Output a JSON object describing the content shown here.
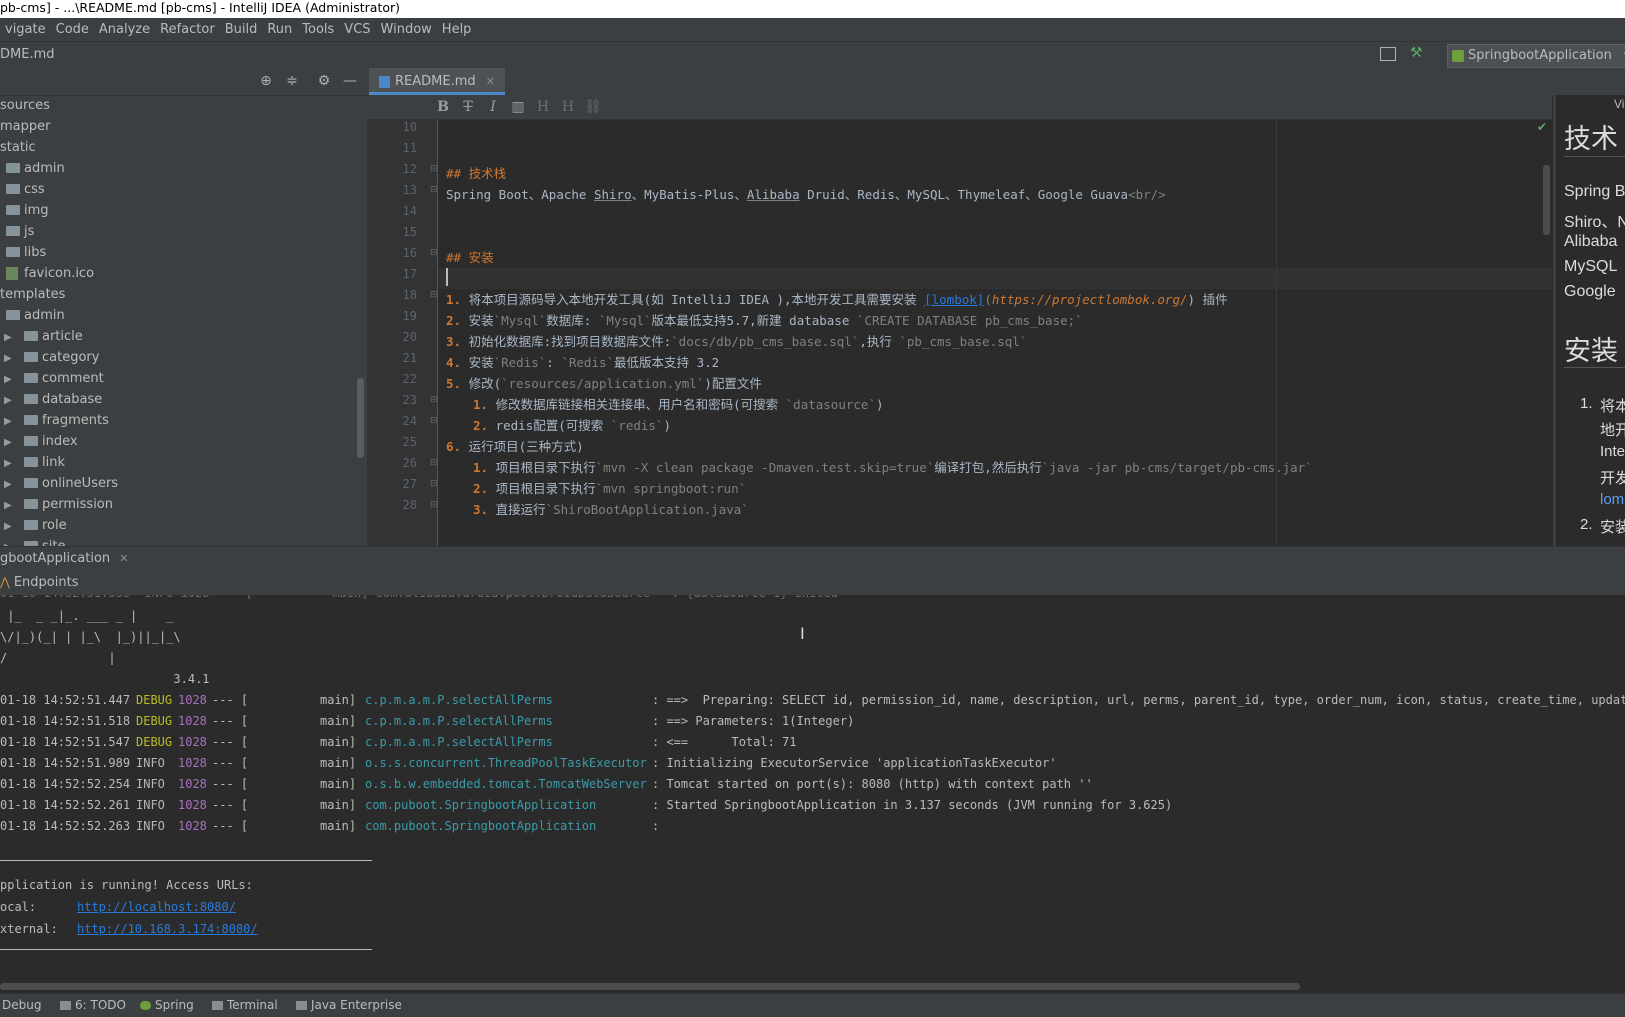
{
  "window": {
    "title": "pb-cms] - ...\\README.md [pb-cms] - IntelliJ IDEA (Administrator)"
  },
  "menu": [
    "vigate",
    "Code",
    "Analyze",
    "Refactor",
    "Build",
    "Run",
    "Tools",
    "VCS",
    "Window",
    "Help"
  ],
  "navbar": {
    "file": "DME.md",
    "run_config": "SpringbootApplication"
  },
  "tree": [
    {
      "label": "sources",
      "indent": 0,
      "type": "text"
    },
    {
      "label": "mapper",
      "indent": 0,
      "type": "text"
    },
    {
      "label": "static",
      "indent": 0,
      "type": "text"
    },
    {
      "label": "admin",
      "indent": 1,
      "type": "folder"
    },
    {
      "label": "css",
      "indent": 1,
      "type": "folder"
    },
    {
      "label": "img",
      "indent": 1,
      "type": "folder"
    },
    {
      "label": "js",
      "indent": 1,
      "type": "folder"
    },
    {
      "label": "libs",
      "indent": 1,
      "type": "folder"
    },
    {
      "label": "favicon.ico",
      "indent": 1,
      "type": "file"
    },
    {
      "label": "templates",
      "indent": 0,
      "type": "text"
    },
    {
      "label": "admin",
      "indent": 1,
      "type": "folder"
    },
    {
      "label": "article",
      "indent": 2,
      "type": "collapsed"
    },
    {
      "label": "category",
      "indent": 2,
      "type": "collapsed"
    },
    {
      "label": "comment",
      "indent": 2,
      "type": "collapsed"
    },
    {
      "label": "database",
      "indent": 2,
      "type": "collapsed"
    },
    {
      "label": "fragments",
      "indent": 2,
      "type": "collapsed"
    },
    {
      "label": "index",
      "indent": 2,
      "type": "collapsed"
    },
    {
      "label": "link",
      "indent": 2,
      "type": "collapsed"
    },
    {
      "label": "onlineUsers",
      "indent": 2,
      "type": "collapsed"
    },
    {
      "label": "permission",
      "indent": 2,
      "type": "collapsed"
    },
    {
      "label": "role",
      "indent": 2,
      "type": "collapsed"
    },
    {
      "label": "site",
      "indent": 2,
      "type": "collapsed"
    }
  ],
  "editor": {
    "tab": "README.md",
    "toolbar": [
      "B",
      "T",
      "I",
      "▥",
      "H",
      "H",
      "⛓"
    ],
    "line_numbers": [
      "10",
      "11",
      "12",
      "13",
      "14",
      "15",
      "16",
      "17",
      "18",
      "19",
      "20",
      "21",
      "22",
      "23",
      "24",
      "25",
      "26",
      "27",
      "28"
    ],
    "l12_hash": "## ",
    "l12_text": "技术栈",
    "l13": [
      "Spring Boot、Apache ",
      "Shiro",
      "、MyBatis-Plus、",
      "Alibaba",
      " Druid、Redis、MySQL、Thymeleaf、Google Guava",
      "<br/>"
    ],
    "l16_hash": "## ",
    "l16_text": "安装",
    "l18": [
      "1.",
      "将本项目源码导入本地开发工具(如 IntelliJ IDEA ),本地开发工具需要安装 ",
      "[lombok]",
      "(",
      "https://projectlombok.org/",
      ") 插件"
    ],
    "l19": [
      "2.",
      "安装",
      "`Mysql`",
      "数据库: ",
      "`Mysql`",
      "版本最低支持5.7,新建 database ",
      "`CREATE DATABASE pb_cms_base;`"
    ],
    "l20": [
      "3.",
      "初始化数据库:找到项目数据库文件:",
      "`docs/db/pb_cms_base.sql`",
      ",执行 ",
      "`pb_cms_base.sql`"
    ],
    "l21": [
      "4.",
      "安装",
      "`Redis`",
      ": ",
      "`Redis`",
      "最低版本支持 3.2"
    ],
    "l22": [
      "5.",
      "修改(",
      "`resources/application.yml`",
      ")配置文件"
    ],
    "l23": [
      "1.",
      "修改数据库链接相关连接串、用户名和密码(可搜索 ",
      "`datasource`",
      ")"
    ],
    "l24": [
      "2.",
      "redis配置(可搜索 ",
      "`redis`",
      ")"
    ],
    "l25": [
      "6.",
      "运行项目(三种方式)"
    ],
    "l26": [
      "1.",
      "项目根目录下执行",
      "`mvn -X clean package -Dmaven.test.skip=true`",
      "编译打包,然后执行",
      "`java -jar pb-cms/target/pb-cms.jar`"
    ],
    "l27": [
      "2.",
      "项目根目录下执行",
      "`mvn springboot:run`"
    ],
    "l28": [
      "3.",
      "直接运行",
      "`ShiroBootApplication.java`"
    ]
  },
  "preview": {
    "title": "Vi",
    "h1": "技术",
    "lines": [
      "Spring B",
      "Shiro、N",
      "Alibaba",
      "MySQL",
      "Google"
    ],
    "h2": "安装",
    "ol": [
      "1.",
      "将本",
      "地开",
      "Inte",
      "开发",
      "lom",
      "2.",
      "安装"
    ]
  },
  "run": {
    "tab": "gbootApplication",
    "endpoints": "Endpoints",
    "banner": [
      " |_  _ _|_. ___ _ |    _ ",
      "\\/|_)(_| | |_\\  |_)||_|_\\ ",
      "/              |         ",
      "                        3.4.1 "
    ],
    "logs": [
      {
        "time": "01-18 14:52:51.447",
        "level": "DEBUG",
        "pid": "1028",
        "thread": "main]",
        "logger": "c.p.m.a.m.P.selectAllPerms",
        "msg": ": ==>  Preparing: SELECT id, permission_id, name, description, url, perms, parent_id, type, order_num, icon, status, create_time, update_ti"
      },
      {
        "time": "01-18 14:52:51.518",
        "level": "DEBUG",
        "pid": "1028",
        "thread": "main]",
        "logger": "c.p.m.a.m.P.selectAllPerms",
        "msg": ": ==> Parameters: 1(Integer)"
      },
      {
        "time": "01-18 14:52:51.547",
        "level": "DEBUG",
        "pid": "1028",
        "thread": "main]",
        "logger": "c.p.m.a.m.P.selectAllPerms",
        "msg": ": <==      Total: 71"
      },
      {
        "time": "01-18 14:52:51.989",
        "level": "INFO",
        "pid": "1028",
        "thread": "main]",
        "logger": "o.s.s.concurrent.ThreadPoolTaskExecutor",
        "msg": ": Initializing ExecutorService 'applicationTaskExecutor'"
      },
      {
        "time": "01-18 14:52:52.254",
        "level": "INFO",
        "pid": "1028",
        "thread": "main]",
        "logger": "o.s.b.w.embedded.tomcat.TomcatWebServer",
        "msg": ": Tomcat started on port(s): 8080 (http) with context path ''"
      },
      {
        "time": "01-18 14:52:52.261",
        "level": "INFO",
        "pid": "1028",
        "thread": "main]",
        "logger": "com.puboot.SpringbootApplication",
        "msg": ": Started SpringbootApplication in 3.137 seconds (JVM running for 3.625)"
      },
      {
        "time": "01-18 14:52:52.263",
        "level": "INFO",
        "pid": "1028",
        "thread": "main]",
        "logger": "com.puboot.SpringbootApplication",
        "msg": ":"
      }
    ],
    "running_msg": "pplication is running! Access URLs:",
    "local_label": "ocal:",
    "local_url": "http://localhost:8080/",
    "external_label": "xternal:",
    "external_url": "http://10.168.3.174:8080/"
  },
  "bottom": [
    {
      "label": "Debug"
    },
    {
      "label": "6: TODO"
    },
    {
      "label": "Spring"
    },
    {
      "label": "Terminal"
    },
    {
      "label": "Java Enterprise"
    }
  ]
}
